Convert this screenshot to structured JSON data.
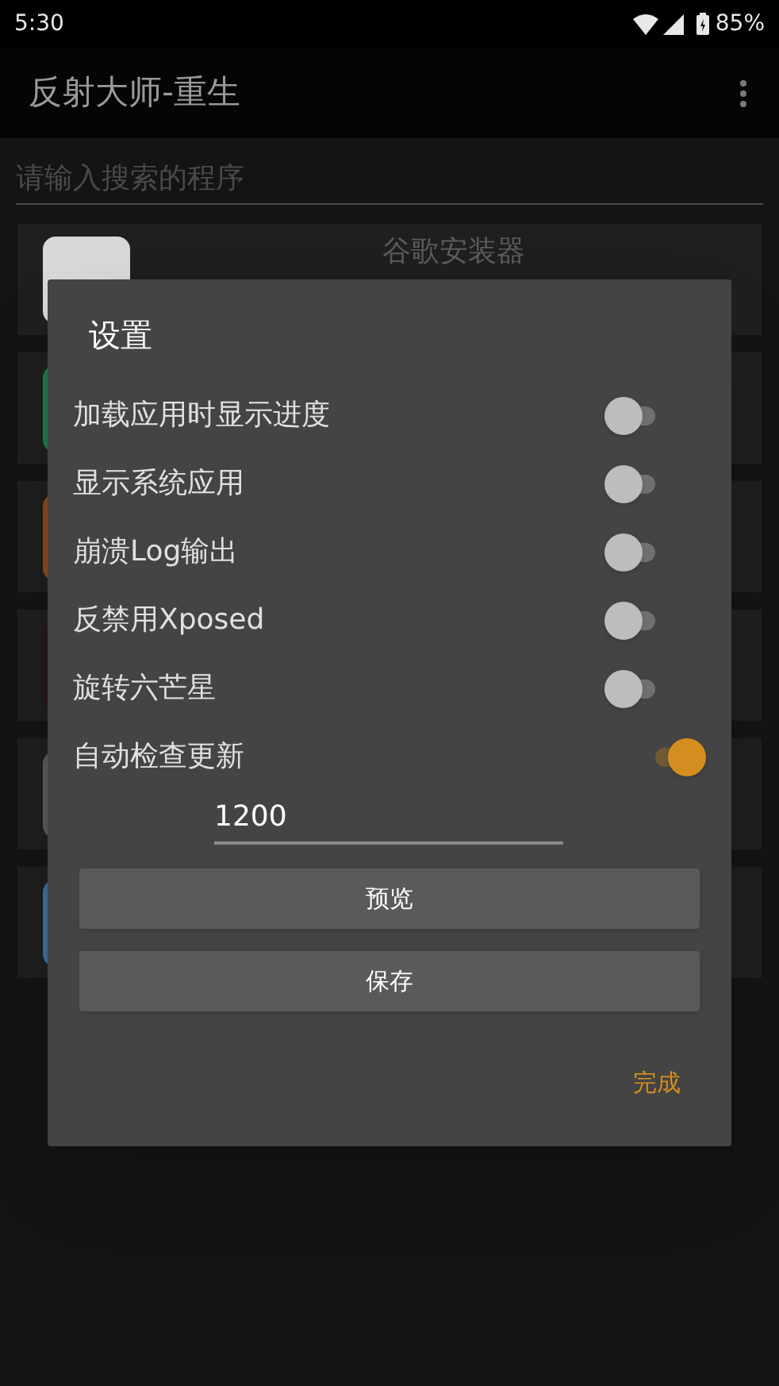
{
  "status_bar": {
    "time": "5:30",
    "battery": "85%"
  },
  "app_bar": {
    "title": "反射大师-重生"
  },
  "search": {
    "placeholder": "请输入搜索的程序"
  },
  "apps": [
    {
      "name": "谷歌安装器",
      "color": "#d8d8d8"
    },
    {
      "color": "#1e7a4a"
    },
    {
      "color": "#8a4a1e"
    },
    {
      "color": "#2a1414"
    },
    {
      "color": "#5a5a5a"
    },
    {
      "color": "#3d6f99"
    }
  ],
  "dialog": {
    "title": "设置",
    "settings": [
      {
        "label": "加载应用时显示进度",
        "on": false
      },
      {
        "label": "显示系统应用",
        "on": false
      },
      {
        "label": "崩溃Log输出",
        "on": false
      },
      {
        "label": "反禁用Xposed",
        "on": false
      },
      {
        "label": "旋转六芒星",
        "on": false
      },
      {
        "label": "自动检查更新",
        "on": true
      }
    ],
    "interval": {
      "value": "1200"
    },
    "buttons": [
      "预览",
      "保存"
    ],
    "done": "完成"
  }
}
